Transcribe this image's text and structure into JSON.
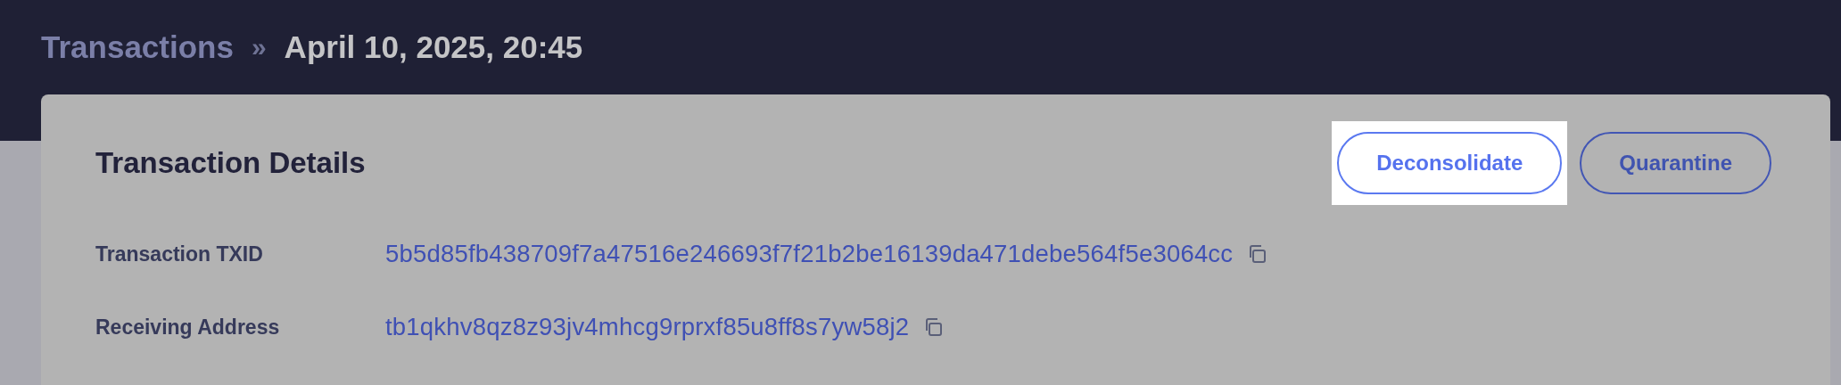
{
  "breadcrumb": {
    "parent": "Transactions",
    "separator": "»",
    "current": "April 10, 2025, 20:45"
  },
  "card": {
    "title": "Transaction Details",
    "actions": [
      {
        "label": "Deconsolidate",
        "highlighted": true
      },
      {
        "label": "Quarantine",
        "highlighted": false
      }
    ],
    "fields": [
      {
        "label": "Transaction TXID",
        "value": "5b5d85fb438709f7a47516e246693f7f21b2be16139da471debe564f5e3064cc"
      },
      {
        "label": "Receiving Address",
        "value": "tb1qkhv8qz8z93jv4mhcg9rprxf85u8ff8s7yw58j2"
      }
    ]
  }
}
